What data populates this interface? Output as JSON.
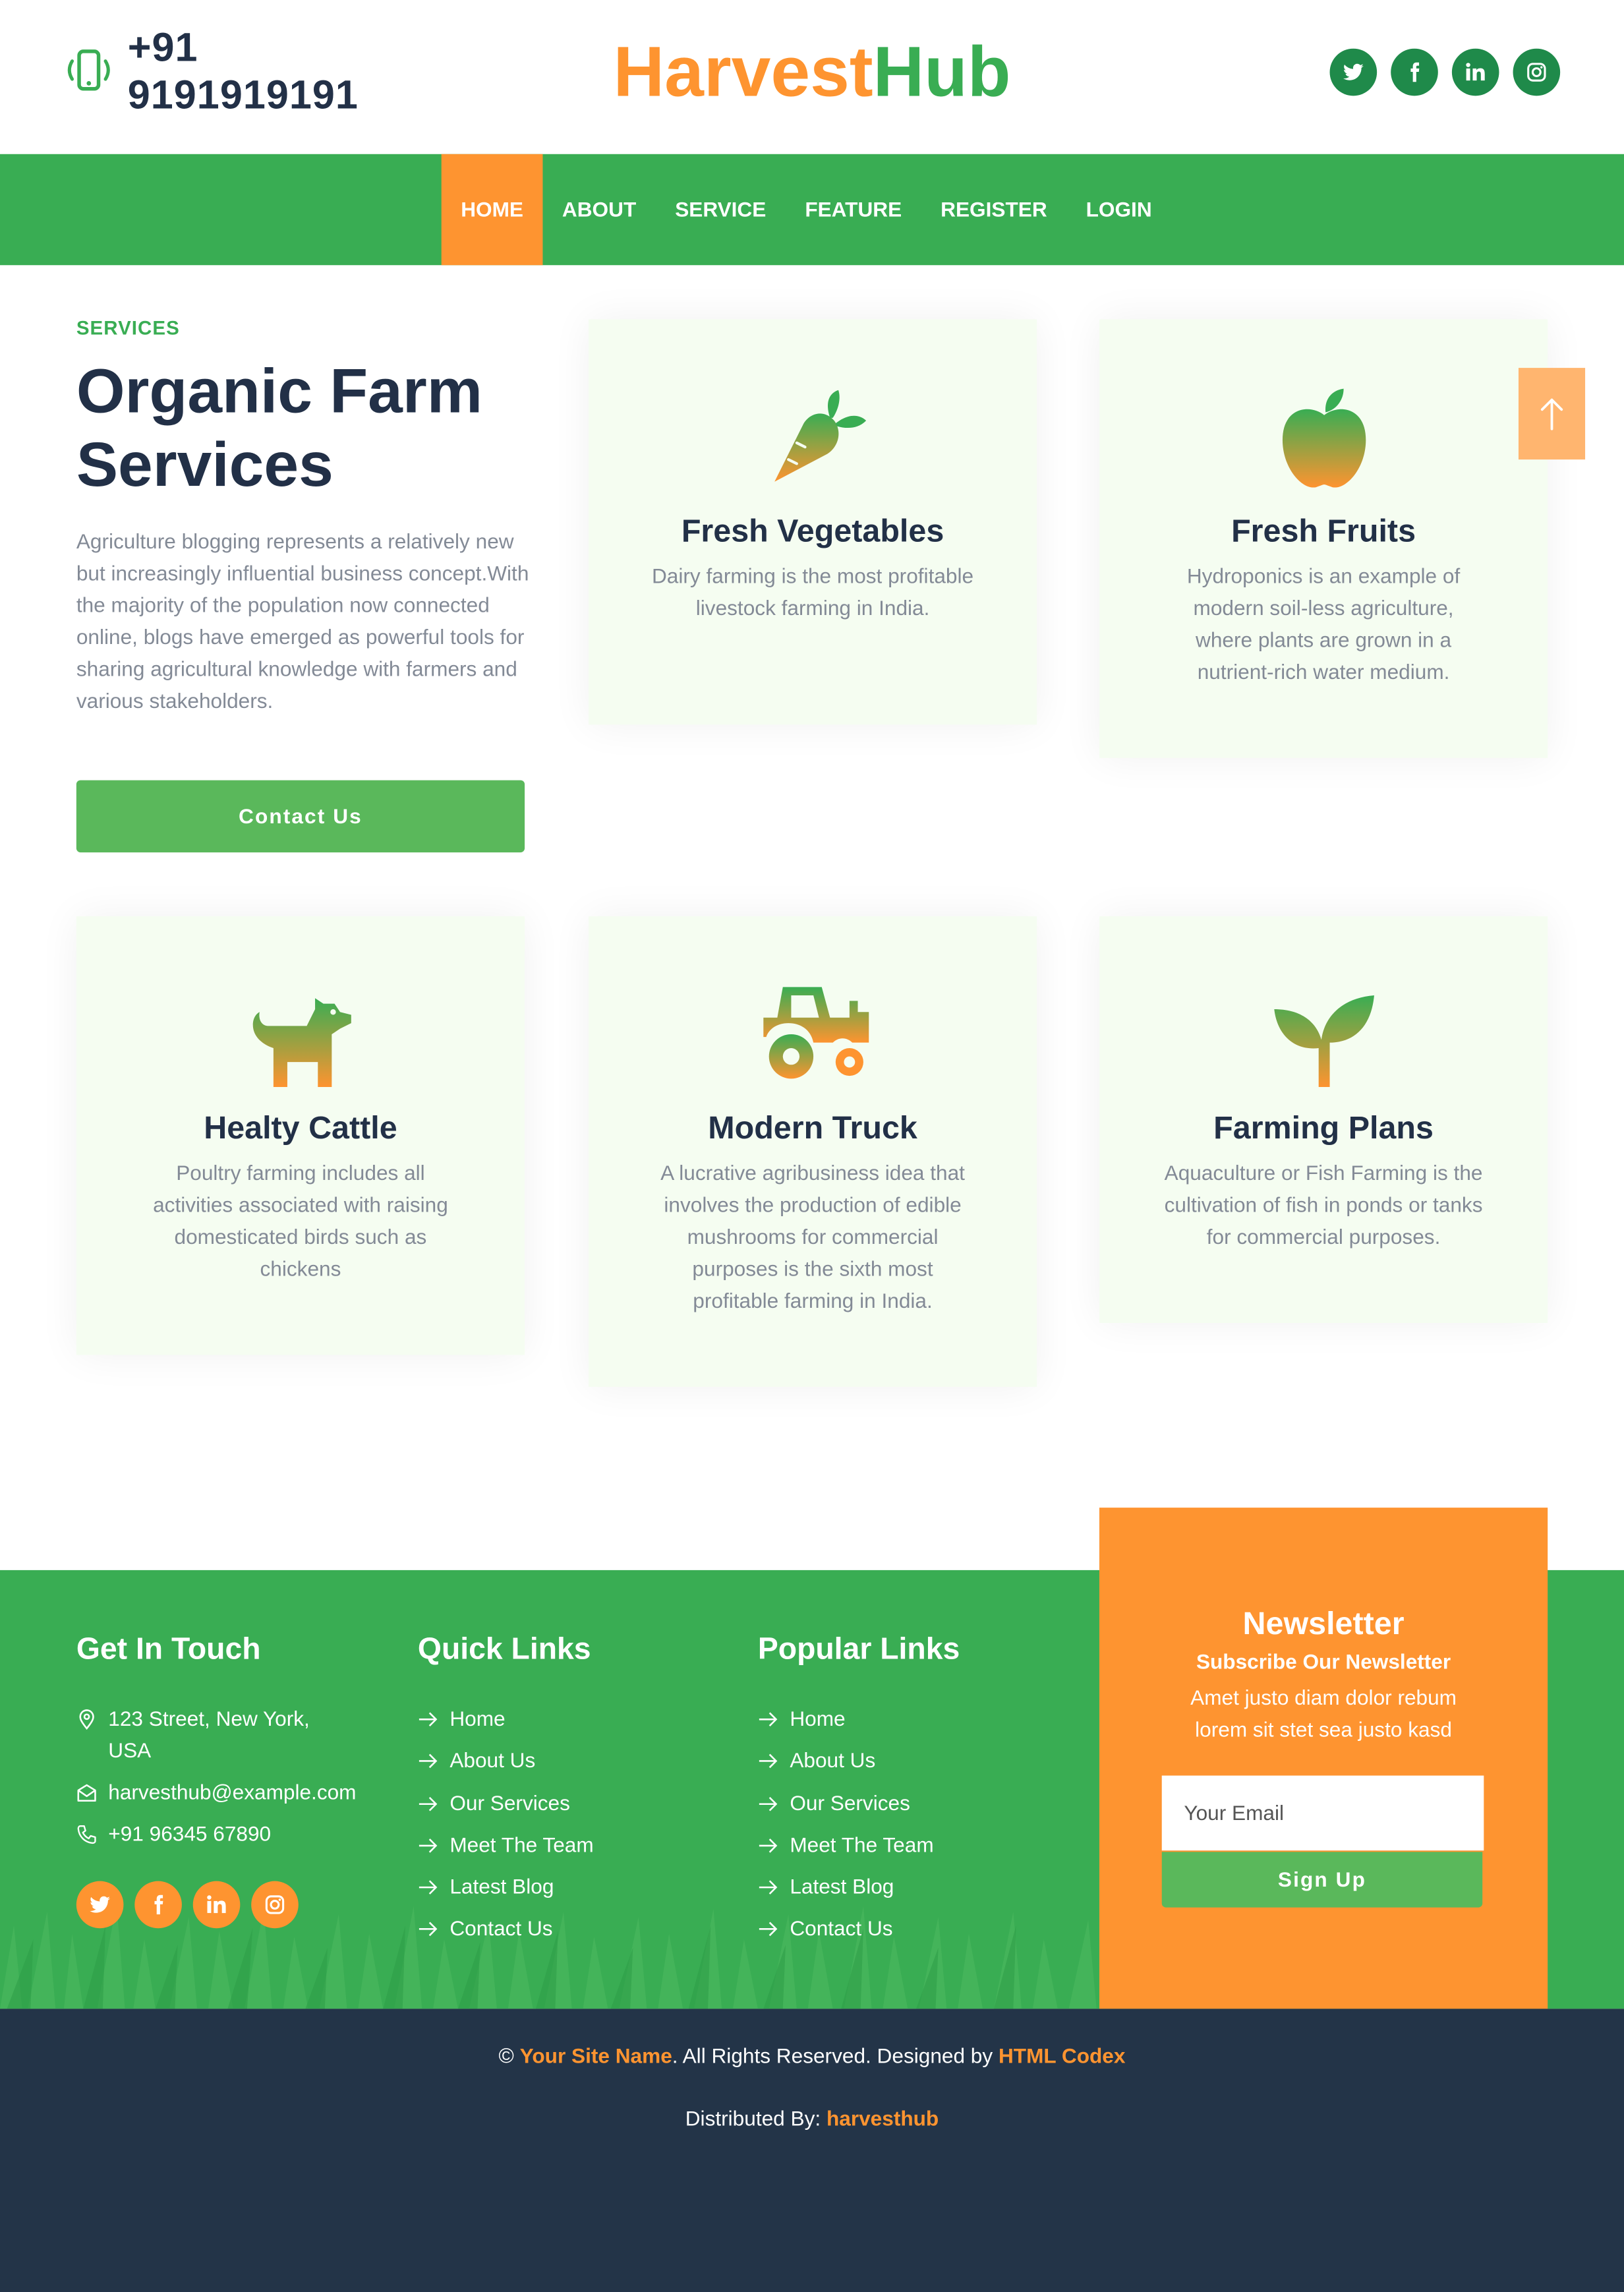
{
  "header": {
    "phone": "+91 9191919191",
    "brand_part1": "Harvest",
    "brand_part2": "Hub",
    "social_icons": [
      "twitter-icon",
      "facebook-icon",
      "linkedin-icon",
      "instagram-icon"
    ]
  },
  "nav": {
    "items": [
      {
        "label": "HOME",
        "active": true
      },
      {
        "label": "ABOUT"
      },
      {
        "label": "SERVICE"
      },
      {
        "label": "FEATURE"
      },
      {
        "label": "REGISTER"
      },
      {
        "label": "LOGIN"
      }
    ]
  },
  "intro": {
    "eyebrow": "SERVICES",
    "title": "Organic Farm Services",
    "text": "Agriculture blogging represents a relatively new but increasingly influential business concept.With the majority of the population now connected online, blogs have emerged as powerful tools for sharing agricultural knowledge with farmers and various stakeholders.",
    "button": "Contact Us"
  },
  "services": [
    {
      "icon": "carrot-icon",
      "title": "Fresh Vegetables",
      "text": "Dairy farming is the most profitable livestock farming in India."
    },
    {
      "icon": "apple-icon",
      "title": "Fresh Fruits",
      "text": "Hydroponics is an example of modern soil-less agriculture, where plants are grown in a nutrient-rich water medium."
    },
    {
      "icon": "dog-icon",
      "title": "Healty Cattle",
      "text": "Poultry farming includes all activities associated with raising domesticated birds such as chickens"
    },
    {
      "icon": "tractor-icon",
      "title": "Modern Truck",
      "text": "A lucrative agribusiness idea that involves the production of edible mushrooms for commercial purposes is the sixth most profitable farming in India."
    },
    {
      "icon": "seedling-icon",
      "title": "Farming Plans",
      "text": "Aquaculture or Fish Farming is the cultivation of fish in ponds or tanks for commercial purposes."
    }
  ],
  "footer": {
    "touch": {
      "title": "Get In Touch",
      "address": "123 Street, New York, USA",
      "email": "harvesthub@example.com",
      "phone": "+91 96345 67890"
    },
    "quick": {
      "title": "Quick Links",
      "items": [
        "Home",
        "About Us",
        "Our Services",
        "Meet The Team",
        "Latest Blog",
        "Contact Us"
      ]
    },
    "popular": {
      "title": "Popular Links",
      "items": [
        "Home",
        "About Us",
        "Our Services",
        "Meet The Team",
        "Latest Blog",
        "Contact Us"
      ]
    },
    "newsletter": {
      "title": "Newsletter",
      "subtitle": "Subscribe Our Newsletter",
      "text": "Amet justo diam dolor rebum lorem sit stet sea justo kasd",
      "placeholder": "Your Email",
      "button": "Sign Up"
    }
  },
  "copyright": {
    "prefix": "©",
    "site": "Your Site Name",
    "middle": ". All Rights Reserved. Designed by",
    "designer": "HTML Codex",
    "distributed_label": "Distributed By:",
    "distributor": "harvesthub"
  },
  "colors": {
    "green": "#39ad53",
    "orange": "#fe9430",
    "navy": "#233448",
    "button_green": "#5ab85b"
  }
}
